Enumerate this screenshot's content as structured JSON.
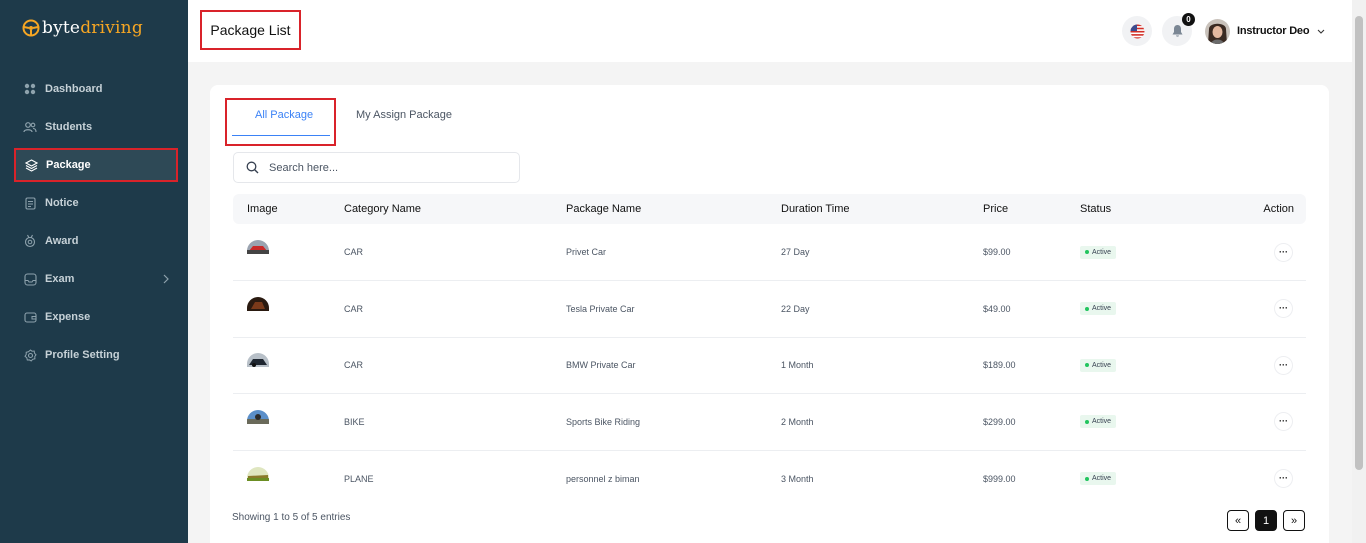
{
  "brand": {
    "part1": "byte",
    "part2": "driving",
    "accent_color": "#f6a623"
  },
  "sidebar": {
    "background": "#1e3a4a",
    "items": [
      {
        "label": "Dashboard",
        "icon": "grid-icon"
      },
      {
        "label": "Students",
        "icon": "users-icon"
      },
      {
        "label": "Package",
        "icon": "layers-icon",
        "active": true
      },
      {
        "label": "Notice",
        "icon": "document-icon"
      },
      {
        "label": "Award",
        "icon": "award-icon"
      },
      {
        "label": "Exam",
        "icon": "exam-icon",
        "has_submenu": true
      },
      {
        "label": "Expense",
        "icon": "wallet-icon"
      },
      {
        "label": "Profile Setting",
        "icon": "settings-icon"
      }
    ]
  },
  "header": {
    "title": "Package List",
    "notification_count": "0",
    "user_name": "Instructor Deo",
    "language_icon": "us-flag-icon"
  },
  "tabs": [
    {
      "label": "All Package",
      "active": true
    },
    {
      "label": "My Assign Package",
      "active": false
    }
  ],
  "search": {
    "placeholder": "Search here...",
    "value": ""
  },
  "table": {
    "columns": [
      "Image",
      "Category Name",
      "Package Name",
      "Duration Time",
      "Price",
      "Status",
      "Action"
    ],
    "rows": [
      {
        "category": "CAR",
        "package": "Privet Car",
        "duration": "27 Day",
        "price": "$99.00",
        "status": "Active"
      },
      {
        "category": "CAR",
        "package": "Tesla Private Car",
        "duration": "22 Day",
        "price": "$49.00",
        "status": "Active"
      },
      {
        "category": "CAR",
        "package": "BMW Private Car",
        "duration": "1 Month",
        "price": "$189.00",
        "status": "Active"
      },
      {
        "category": "BIKE",
        "package": "Sports Bike Riding",
        "duration": "2 Month",
        "price": "$299.00",
        "status": "Active"
      },
      {
        "category": "PLANE",
        "package": "personnel z biman",
        "duration": "3 Month",
        "price": "$999.00",
        "status": "Active"
      }
    ]
  },
  "footer": {
    "entries_text": "Showing 1 to 5 of 5 entries",
    "pager": {
      "prev": "«",
      "current": "1",
      "next": "»"
    }
  },
  "colors": {
    "highlight_border": "#d9232a",
    "tab_active": "#3b82f6",
    "status_dot": "#22c55e"
  }
}
